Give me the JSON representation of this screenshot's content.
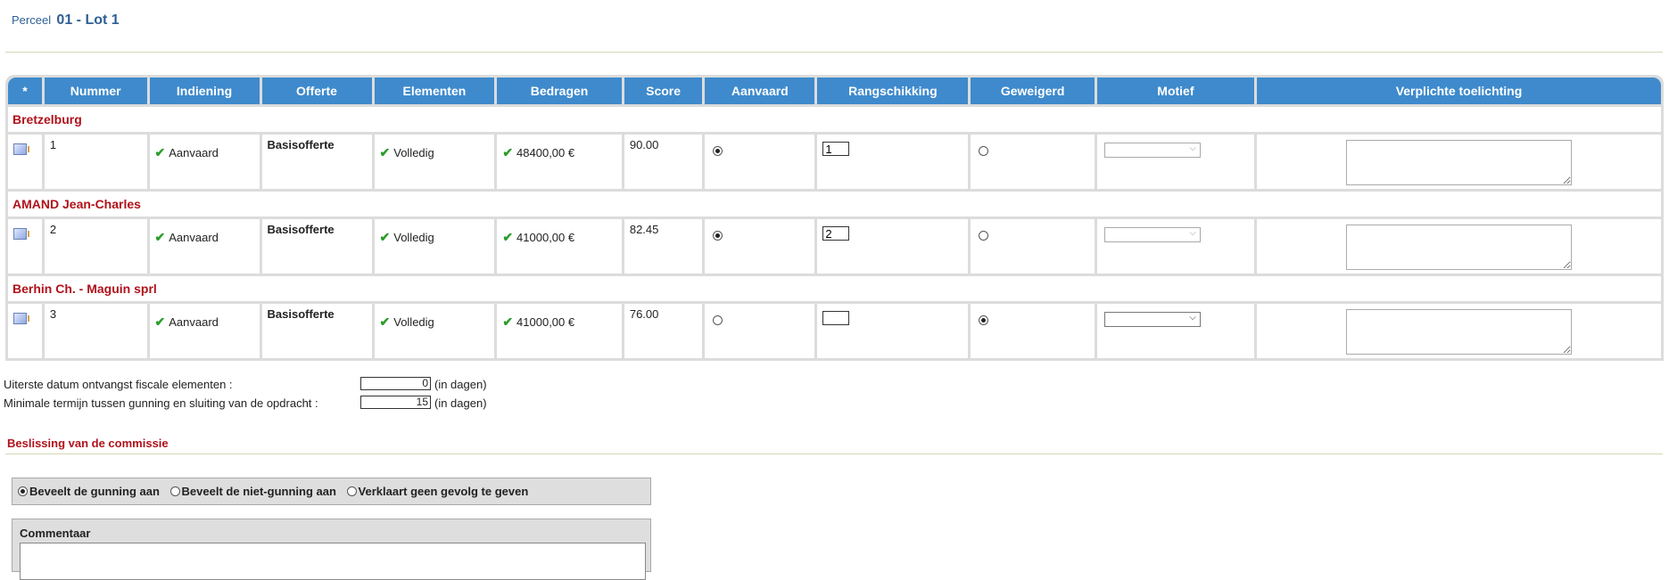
{
  "header": {
    "prefix": "Perceel",
    "lot": "01 - Lot 1"
  },
  "table": {
    "columns": [
      "*",
      "Nummer",
      "Indiening",
      "Offerte",
      "Elementen",
      "Bedragen",
      "Score",
      "Aanvaard",
      "Rangschikking",
      "Geweigerd",
      "Motief",
      "Verplichte toelichting"
    ],
    "rows": [
      {
        "company": "Bretzelburg",
        "nummer": "1",
        "indiening": "Aanvaard",
        "offerte": "Basisofferte",
        "elementen": "Volledig",
        "bedragen": "48400,00 €",
        "score": "90.00",
        "aanvaard": true,
        "rang": "1",
        "geweigerd": false
      },
      {
        "company": "AMAND Jean-Charles",
        "nummer": "2",
        "indiening": "Aanvaard",
        "offerte": "Basisofferte",
        "elementen": "Volledig",
        "bedragen": "41000,00 €",
        "score": "82.45",
        "aanvaard": true,
        "rang": "2",
        "geweigerd": false
      },
      {
        "company": "Berhin Ch. - Maguin sprl",
        "nummer": "3",
        "indiening": "Aanvaard",
        "offerte": "Basisofferte",
        "elementen": "Volledig",
        "bedragen": "41000,00 €",
        "score": "76.00",
        "aanvaard": false,
        "rang": "",
        "geweigerd": true
      }
    ]
  },
  "fields": {
    "fiscal_label": "Uiterste datum ontvangst fiscale elementen :",
    "fiscal_value": "0",
    "term_label": "Minimale termijn tussen gunning en sluiting van de opdracht :",
    "term_value": "15",
    "unit": "(in dagen)"
  },
  "decision": {
    "title": "Beslissing van de commissie",
    "options": [
      "Beveelt de gunning aan",
      "Beveelt de niet-gunning aan",
      "Verklaart geen gevolg te geven"
    ],
    "selected": 0
  },
  "comment": {
    "label": "Commentaar"
  },
  "icons": {
    "row_icon": "document-icon",
    "status_icon": "checkmark-icon"
  },
  "colors": {
    "header_bg": "#3e8acc",
    "company_text": "#b0121b",
    "title_text": "#2e5f94",
    "check": "#2a9d2a"
  }
}
